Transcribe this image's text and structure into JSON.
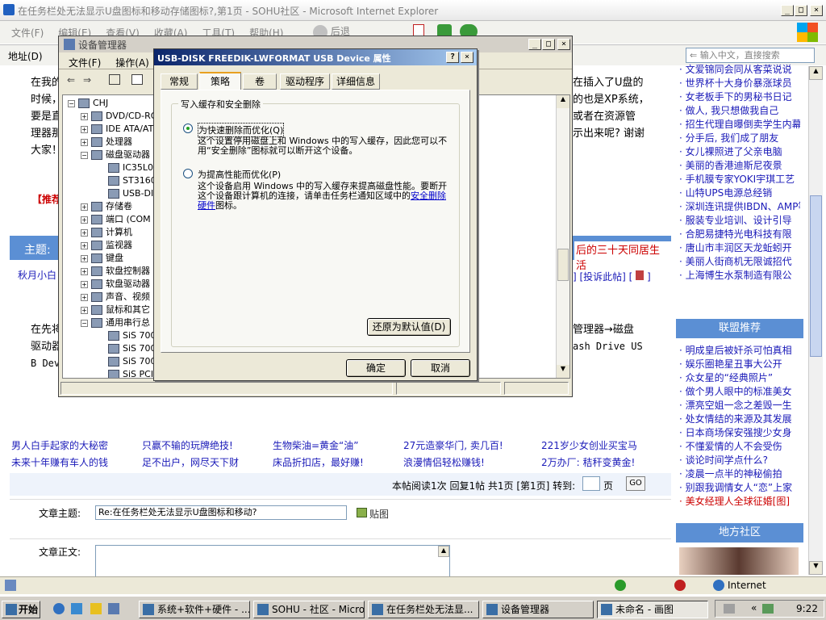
{
  "ie": {
    "title": "在任务栏处无法显示U盘图标和移动存储图标?,第1页 - SOHU社区 - Microsoft Internet Explorer",
    "menu": [
      "文件(F)",
      "编辑(E)",
      "查看(V)",
      "收藏(A)",
      "工具(T)",
      "帮助(H)"
    ],
    "address_label": "地址(D)",
    "back": "后退",
    "search_placeholder": "输入中文，直接搜索",
    "status_zone": "Internet"
  },
  "article": {
    "para1": [
      "在我的",
      "时候，",
      "要是直",
      "理器那",
      "大家！"
    ],
    "para1_right": [
      "在插入了U盘的",
      "的也是XP系统，",
      "或者在资源管",
      "示出来呢? 谢谢",
      ""
    ],
    "recommend": "【推荐",
    "subject_label": "主题:",
    "subject_right": "后的三十天同居生活",
    "author": "秋月小白",
    "reply_links": "] [投诉此帖] [",
    "para2": [
      "在先将",
      "驱动器",
      "B Dev"
    ],
    "para2_right": [
      "管理器→磁盘",
      "ash Drive US"
    ]
  },
  "ads": {
    "row1": [
      "男人白手起家的大秘密",
      "只赢不输的玩牌绝技!",
      "生物柴油=黄金“油”",
      "27元造豪华门, 卖几百!",
      "221岁少女创业买宝马"
    ],
    "row2": [
      "未来十年赚有车人的钱",
      "足不出户，网尽天下财",
      "床品折扣店，最好赚!",
      "浪漫情侣轻松赚钱!",
      "2万办厂: 秸秆变黄金!"
    ]
  },
  "pager": {
    "text": "本帖阅读1次 回复1帖 共1页 [第1页] 转到:",
    "page_unit": "页",
    "go": "GO"
  },
  "reply": {
    "subject_label": "文章主题:",
    "subject_value": "Re:在任务栏处无法显示U盘图标和移动?",
    "attach": "贴图",
    "body_label": "文章正文:"
  },
  "sidebar": {
    "top_list": [
      "文爱锦同会同从客菜说说",
      "世界杯十大身价暴涨球员",
      "女老板手下的男秘书日记",
      "做人, 我只想做我自己",
      "招生代理自曝倒卖学生内幕",
      "分手后, 我们成了朋友",
      "女儿裸照进了父亲电脑",
      "美丽的香港迪斯尼夜景",
      "手机膜专家YOKI宇琪工艺",
      "山特UPS电源总经销",
      "深圳连讯提供IBDN、AMP等",
      "服装专业培训、设计引导",
      "合肥易捷特光电科技有限",
      "唐山市丰润区天龙蚯蚓开",
      "美丽人街商机无限诚招代",
      "上海博生水泵制造有限公"
    ],
    "union_header": "联盟推荐",
    "union_list": [
      "明成皇后被奸杀可怕真相",
      "娱乐圈艳星丑事大公开",
      "众女星的“经典照片”",
      "做个男人眼中的标准美女",
      "漂亮空姐一念之差毁一生",
      "处女情结的来源及其发展",
      "日本商场保安强搜少女身",
      "不懂爱情的人不会受伤",
      "谈论时间学点什么?",
      "凌晨一点半的神秘偷拍",
      "别跟我调情女人“恋”上家",
      "美女经理人全球征婚[图]"
    ],
    "local_header": "地方社区"
  },
  "devmgr": {
    "title": "设备管理器",
    "menu": [
      "文件(F)",
      "操作(A)"
    ],
    "tree": [
      "CHJ",
      "DVD/CD-RO",
      "IDE ATA/AT",
      "处理器",
      "磁盘驱动器",
      "IC35L0",
      "ST3160",
      "USB-DI",
      "存储卷",
      "端口 (COM",
      "计算机",
      "监视器",
      "键盘",
      "软盘控制器",
      "软盘驱动器",
      "声音、视频",
      "鼠标和其它",
      "通用串行总",
      "SiS 700",
      "SiS 700",
      "SiS 700",
      "SiS PCI"
    ]
  },
  "props": {
    "title": "USB-DISK FREEDIK-LWFORMAT USB Device 属性",
    "tabs": [
      "常规",
      "策略",
      "卷",
      "驱动程序",
      "详细信息"
    ],
    "group_title": "写入缓存和安全删除",
    "opt1_label": "为快速删除而优化(Q)",
    "opt1_desc": "这个设置停用磁盘上和 Windows 中的写入缓存，因此您可以不用“安全删除”图标就可以断开这个设备。",
    "opt2_label": "为提高性能而优化(P)",
    "opt2_desc_a": "这个设备启用 Windows 中的写入缓存来提高磁盘性能。要断开这个设备跟计算机的连接，请单击任务栏通知区域中的",
    "opt2_link": "安全删除硬件",
    "opt2_desc_b": "图标。",
    "restore": "还原为默认值(D)",
    "ok": "确定",
    "cancel": "取消",
    "help": "?"
  },
  "taskbar": {
    "start": "开始",
    "tasks": [
      "系统+软件+硬件 - ...",
      "SOHU - 社区 - Micro...",
      "在任务栏处无法显...",
      "设备管理器",
      "未命名 - 画图"
    ],
    "clock": "9:22"
  },
  "colors": {
    "desktop_blue": "#0a246a",
    "dialog_bg": "#ece9d8",
    "link_blue": "#1a1ab8",
    "sidebar_header": "#5b8fd4",
    "red": "#cc0000"
  }
}
